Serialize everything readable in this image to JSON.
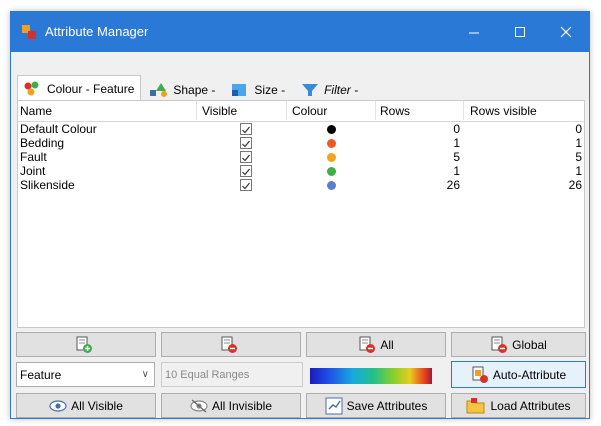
{
  "window": {
    "title": "Attribute Manager",
    "accent": "#2b79d6"
  },
  "tabs": [
    {
      "label": "Colour - Feature",
      "icon": "palette-icon",
      "active": true
    },
    {
      "label": "Shape -",
      "icon": "shapes-icon",
      "active": false
    },
    {
      "label": "Size -",
      "icon": "resize-icon",
      "active": false
    },
    {
      "label": "Filter -",
      "icon": "filter-icon",
      "active": false
    }
  ],
  "table": {
    "headers": [
      "Name",
      "Visible",
      "Colour",
      "Rows",
      "Rows visible"
    ],
    "rows": [
      {
        "name": "Default Colour",
        "visible": true,
        "colour": "#000000",
        "rows": "0",
        "rows_visible": "0"
      },
      {
        "name": "Bedding",
        "visible": true,
        "colour": "#f05a22",
        "rows": "1",
        "rows_visible": "1"
      },
      {
        "name": "Fault",
        "visible": true,
        "colour": "#f5a31a",
        "rows": "5",
        "rows_visible": "5"
      },
      {
        "name": "Joint",
        "visible": true,
        "colour": "#3fae49",
        "rows": "1",
        "rows_visible": "1"
      },
      {
        "name": "Slikenside",
        "visible": true,
        "colour": "#5b7fc9",
        "rows": "26",
        "rows_visible": "26"
      }
    ]
  },
  "buttons_top": {
    "add": "",
    "remove": "",
    "remove_all": "All",
    "remove_global": "Global"
  },
  "controls": {
    "feature_select": "Feature",
    "range_field": "10 Equal Ranges",
    "auto_attribute": "Auto-Attribute"
  },
  "buttons_bottom": {
    "all_visible": "All Visible",
    "all_invisible": "All Invisible",
    "save": "Save Attributes",
    "load": "Load Attributes"
  }
}
